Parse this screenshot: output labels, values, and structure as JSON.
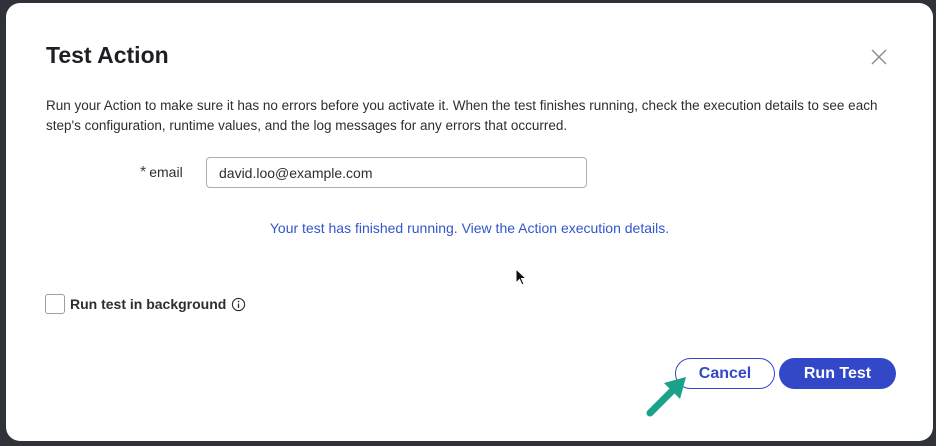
{
  "dialog": {
    "title": "Test Action",
    "description": "Run your Action to make sure it has no errors before you activate it. When the test finishes running, check the execution details to see each step's configuration, runtime values, and the log messages for any errors that occurred.",
    "close_icon": "close-icon"
  },
  "form": {
    "required_marker": "*",
    "email_label": "email",
    "email_value": "david.loo@example.com"
  },
  "result": {
    "message": "Your test has finished running. View the Action execution details."
  },
  "background": {
    "checkbox_checked": false,
    "label": "Run test in background",
    "info_icon": "info-icon"
  },
  "buttons": {
    "cancel": "Cancel",
    "run": "Run Test"
  },
  "colors": {
    "accent": "#3348c9",
    "link": "#3355cc",
    "annotation_arrow": "#1aa38a"
  }
}
